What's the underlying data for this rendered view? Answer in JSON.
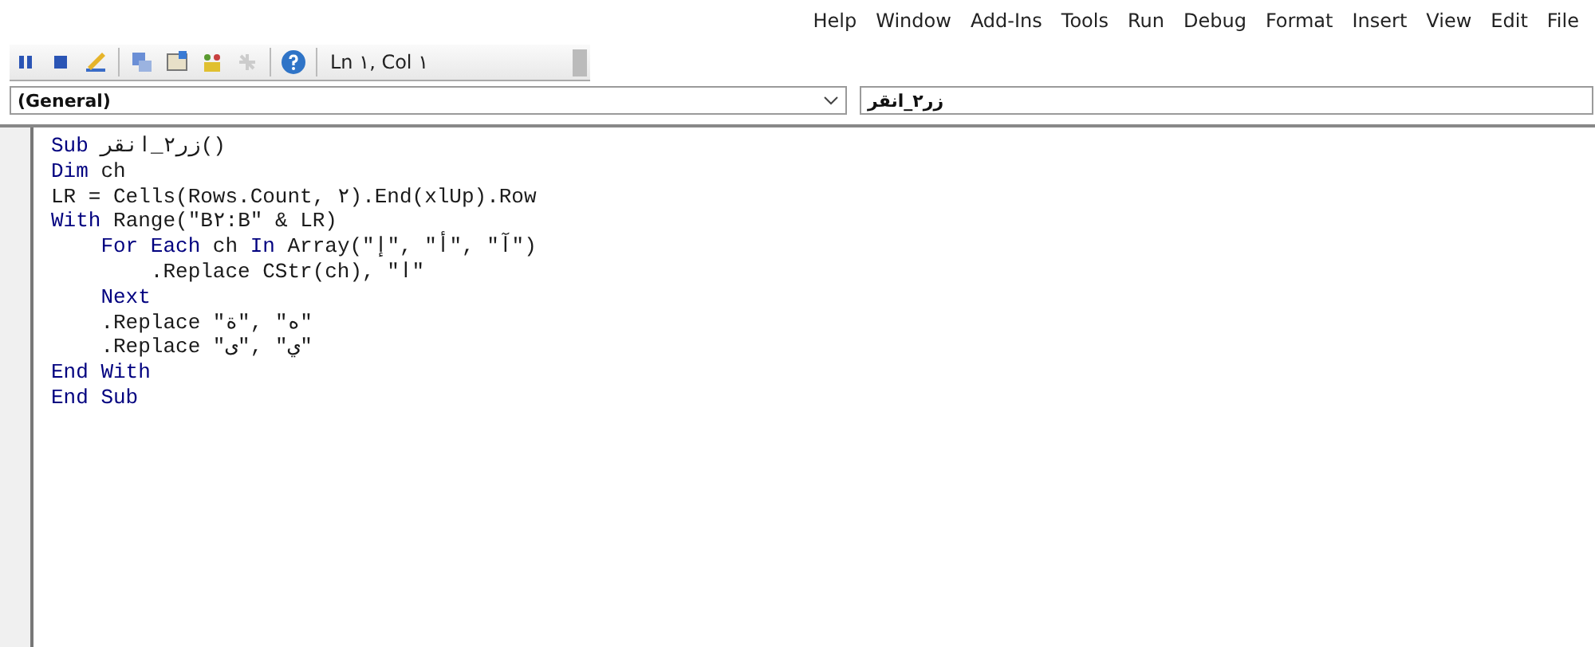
{
  "menu_bar": [
    "Help",
    "Window",
    "Add-Ins",
    "Tools",
    "Run",
    "Debug",
    "Format",
    "Insert",
    "View",
    "Edit",
    "File"
  ],
  "toolbar": {
    "position": "Ln ١, Col ١"
  },
  "object_dropdown": {
    "value": "(General)"
  },
  "procedure_dropdown": {
    "value": "زر٢_انقر"
  },
  "code_lines": [
    [
      {
        "kind": "keyword",
        "text": "Sub"
      },
      {
        "kind": "plain",
        "text": " زر٢_انقر()"
      }
    ],
    [
      {
        "kind": "keyword",
        "text": "Dim"
      },
      {
        "kind": "plain",
        "text": " ch"
      }
    ],
    [
      {
        "kind": "plain",
        "text": "LR = Cells(Rows.Count, ٢).End(xlUp).Row"
      }
    ],
    [
      {
        "kind": "keyword",
        "text": "With"
      },
      {
        "kind": "plain",
        "text": " Range(\"B٢:B\" & LR)"
      }
    ],
    [
      {
        "kind": "keyword",
        "text": "    For Each"
      },
      {
        "kind": "plain",
        "text": " ch "
      },
      {
        "kind": "keyword",
        "text": "In"
      },
      {
        "kind": "plain",
        "text": " Array(\""
      },
      {
        "kind": "plain",
        "text": "إ"
      },
      {
        "kind": "plain",
        "text": "\", \""
      },
      {
        "kind": "plain",
        "text": "أ"
      },
      {
        "kind": "plain",
        "text": "\", \""
      },
      {
        "kind": "plain",
        "text": "آ"
      },
      {
        "kind": "plain",
        "text": "\")"
      }
    ],
    [
      {
        "kind": "plain",
        "text": "        .Replace CStr(ch), \"ا\""
      }
    ],
    [
      {
        "kind": "keyword",
        "text": "    Next"
      }
    ],
    [
      {
        "kind": "plain",
        "text": "    .Replace \""
      },
      {
        "kind": "plain",
        "text": "ة"
      },
      {
        "kind": "plain",
        "text": "\", \""
      },
      {
        "kind": "plain",
        "text": "ه"
      },
      {
        "kind": "plain",
        "text": "\""
      }
    ],
    [
      {
        "kind": "plain",
        "text": "    .Replace \""
      },
      {
        "kind": "plain",
        "text": "ى"
      },
      {
        "kind": "plain",
        "text": "\", \""
      },
      {
        "kind": "plain",
        "text": "ي"
      },
      {
        "kind": "plain",
        "text": "\""
      }
    ],
    [
      {
        "kind": "keyword",
        "text": "End With"
      }
    ],
    [
      {
        "kind": "keyword",
        "text": "End Sub"
      }
    ]
  ]
}
